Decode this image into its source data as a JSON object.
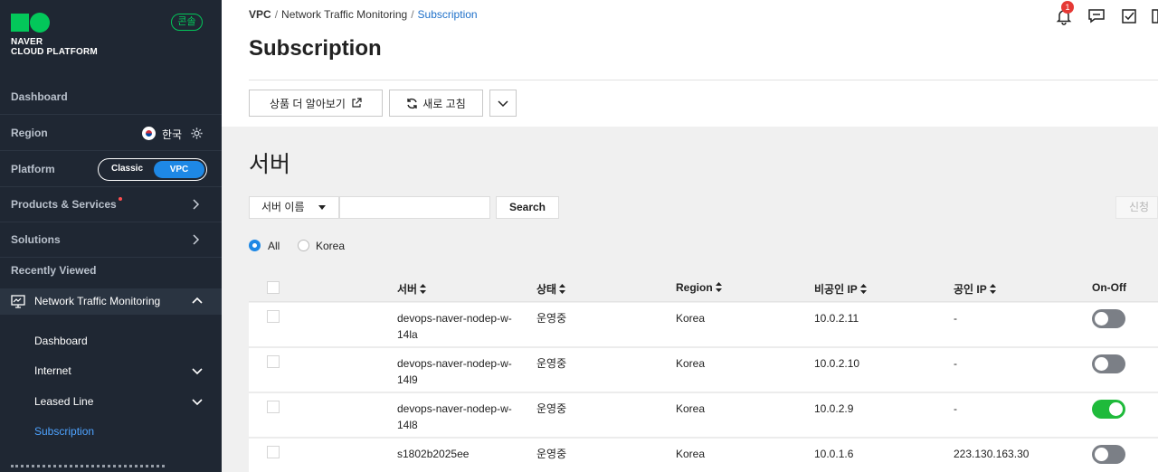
{
  "sidebar": {
    "logo_line1": "NAVER",
    "logo_line2": "CLOUD PLATFORM",
    "console_badge": "콘솔",
    "dashboard": "Dashboard",
    "region_label": "Region",
    "region_value": "한국",
    "platform_label": "Platform",
    "platform_classic": "Classic",
    "platform_vpc": "VPC",
    "products": "Products & Services",
    "solutions": "Solutions",
    "recently_viewed": "Recently Viewed",
    "ntm": "Network Traffic Monitoring",
    "sub_items": [
      "Dashboard",
      "Internet",
      "Leased Line",
      "Subscription"
    ]
  },
  "breadcrumb": [
    "VPC",
    "Network Traffic Monitoring",
    "Subscription"
  ],
  "page_title": "Subscription",
  "notification_count": "1",
  "toolbar": {
    "learn_more": "상품 더 알아보기",
    "refresh": "새로 고침"
  },
  "section_title": "서버",
  "filter": {
    "select_value": "서버 이름",
    "search_placeholder": "",
    "search_button": "Search",
    "apply_button": "신청"
  },
  "radios": {
    "all": "All",
    "korea": "Korea"
  },
  "table": {
    "headers": [
      "서버",
      "상태",
      "Region",
      "비공인 IP",
      "공인 IP",
      "On-Off"
    ],
    "rows": [
      {
        "server_line1": "devops-naver-nodep-w-",
        "server_line2": "14la",
        "status": "운영중",
        "region": "Korea",
        "private_ip": "10.0.2.11",
        "public_ip": "-",
        "on": false
      },
      {
        "server_line1": "devops-naver-nodep-w-",
        "server_line2": "14l9",
        "status": "운영중",
        "region": "Korea",
        "private_ip": "10.0.2.10",
        "public_ip": "-",
        "on": false
      },
      {
        "server_line1": "devops-naver-nodep-w-",
        "server_line2": "14l8",
        "status": "운영중",
        "region": "Korea",
        "private_ip": "10.0.2.9",
        "public_ip": "-",
        "on": true
      },
      {
        "server_line1": "s1802b2025ee",
        "server_line2": "",
        "status": "운영중",
        "region": "Korea",
        "private_ip": "10.0.1.6",
        "public_ip": "223.130.163.30",
        "on": false
      }
    ]
  },
  "colors": {
    "accent": "#1e88e5",
    "brand": "#03c75a",
    "toggle_on": "#1fba3b",
    "sidebar_bg": "#1f2733"
  }
}
